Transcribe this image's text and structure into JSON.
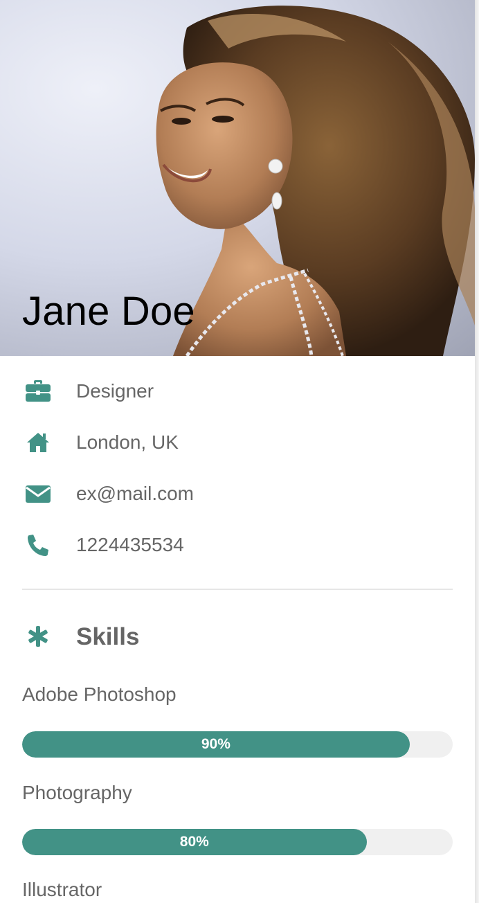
{
  "profile": {
    "name": "Jane Doe",
    "photo": "portrait-photo"
  },
  "info": [
    {
      "icon": "briefcase-icon",
      "text": "Designer"
    },
    {
      "icon": "home-icon",
      "text": "London, UK"
    },
    {
      "icon": "envelope-icon",
      "text": "ex@mail.com"
    },
    {
      "icon": "phone-icon",
      "text": "1224435534"
    }
  ],
  "skills": {
    "icon": "asterisk-icon",
    "title": "Skills",
    "items": [
      {
        "label": "Adobe Photoshop",
        "percent_label": "90%",
        "value": 90
      },
      {
        "label": "Photography",
        "percent_label": "80%",
        "value": 80
      },
      {
        "label": "Illustrator",
        "percent_label": "",
        "value": null
      }
    ]
  },
  "colors": {
    "accent": "#429286",
    "text": "#666666",
    "track": "#f0f0f0",
    "name": "#000000"
  }
}
